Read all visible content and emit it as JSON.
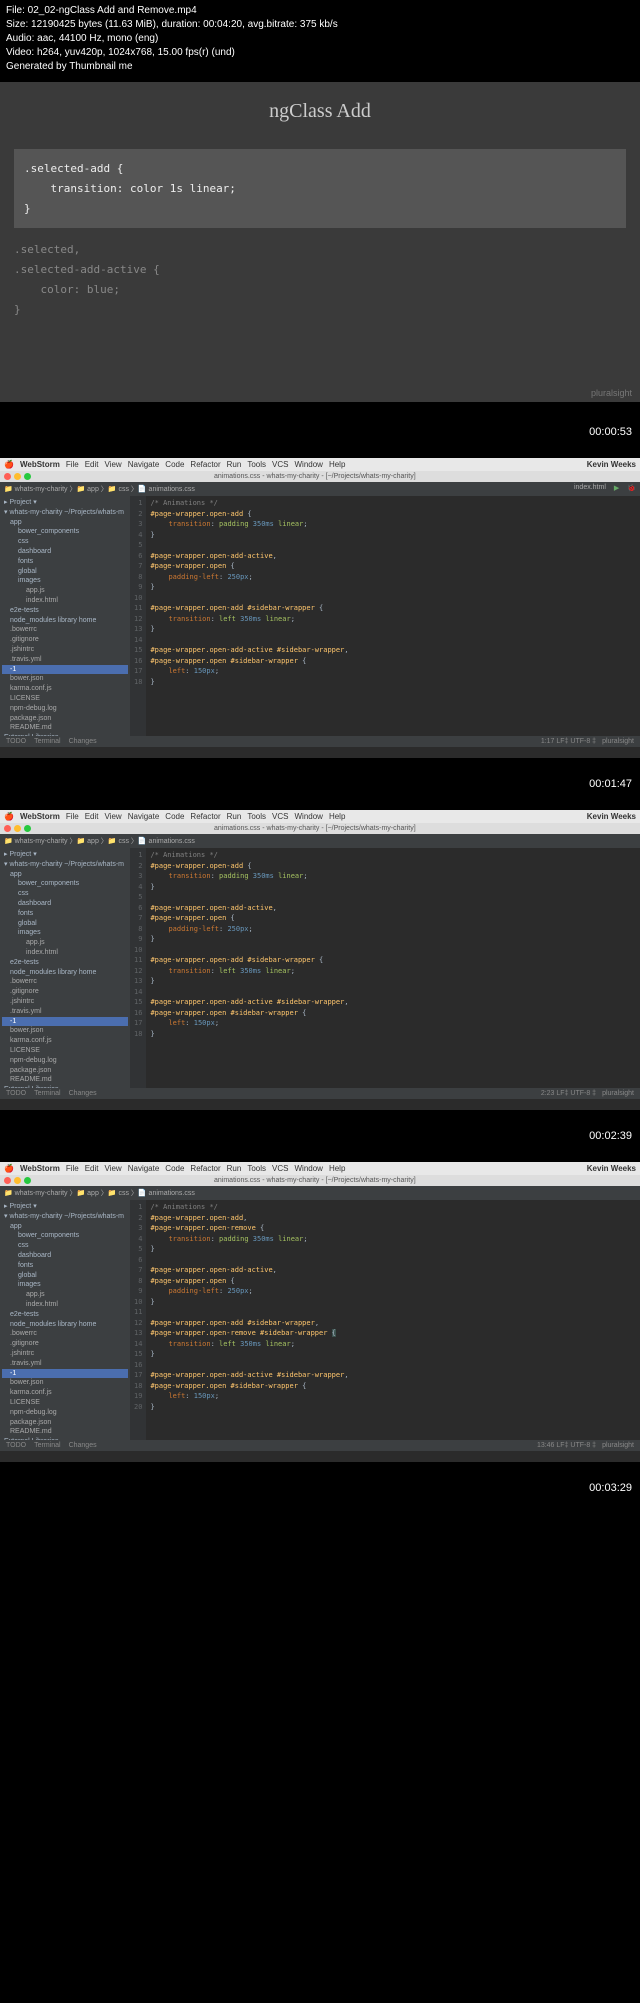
{
  "meta": {
    "file": "File: 02_02-ngClass Add and Remove.mp4",
    "size": "Size: 12190425 bytes (11.63 MiB), duration: 00:04:20, avg.bitrate: 375 kb/s",
    "audio": "Audio: aac, 44100 Hz, mono (eng)",
    "video": "Video: h264, yuv420p, 1024x768, 15.00 fps(r) (und)",
    "gen": "Generated by Thumbnail me"
  },
  "slide1": {
    "title": "ngClass Add",
    "box_l1": ".selected-add {",
    "box_l2": "transition: color 1s linear;",
    "box_l3": "}",
    "faded_l1": ".selected,",
    "faded_l2": ".selected-add-active {",
    "faded_l3": "color: blue;",
    "faded_l4": "}",
    "brand": "pluralsight"
  },
  "ts": {
    "t1": "00:00:53",
    "t2": "00:01:47",
    "t3": "00:02:39",
    "t4": "00:03:29"
  },
  "menu": {
    "app": "WebStorm",
    "items": [
      "File",
      "Edit",
      "View",
      "Navigate",
      "Code",
      "Refactor",
      "Run",
      "Tools",
      "VCS",
      "Window",
      "Help"
    ],
    "user": "Kevin Weeks"
  },
  "tabbar": {
    "path": "animations.css - whats-my-charity - [~/Projects/whats-my-charity]",
    "right": "index.html"
  },
  "tree": {
    "root": "whats-my-charity ~/Projects/whats-m",
    "items": [
      {
        "t": "app",
        "c": "ti1 folder"
      },
      {
        "t": "bower_components",
        "c": "ti2 folder"
      },
      {
        "t": "css",
        "c": "ti2 folder"
      },
      {
        "t": "dashboard",
        "c": "ti2 folder"
      },
      {
        "t": "fonts",
        "c": "ti2 folder"
      },
      {
        "t": "global",
        "c": "ti2 folder"
      },
      {
        "t": "images",
        "c": "ti2 folder"
      },
      {
        "t": "app.js",
        "c": "ti3"
      },
      {
        "t": "index.html",
        "c": "ti3"
      },
      {
        "t": "e2e-tests",
        "c": "ti1 folder"
      },
      {
        "t": "node_modules  library home",
        "c": "ti1 folder"
      },
      {
        "t": ".bowerrc",
        "c": "ti1"
      },
      {
        "t": ".gitignore",
        "c": "ti1"
      },
      {
        "t": ".jshintrc",
        "c": "ti1"
      },
      {
        "t": ".travis.yml",
        "c": "ti1"
      },
      {
        "t": "-1",
        "c": "ti1 sel"
      },
      {
        "t": "bower.json",
        "c": "ti1"
      },
      {
        "t": "karma.conf.js",
        "c": "ti1"
      },
      {
        "t": "LICENSE",
        "c": "ti1"
      },
      {
        "t": "npm-debug.log",
        "c": "ti1"
      },
      {
        "t": "package.json",
        "c": "ti1"
      },
      {
        "t": "README.md",
        "c": "ti1"
      },
      {
        "t": "External Libraries",
        "c": "folder"
      }
    ]
  },
  "editor_tabs": {
    "t1": "index.html",
    "t2": "app.js",
    "t3": "animations.css"
  },
  "code1": {
    "lines": [
      {
        "n": "1",
        "h": "<span class='c-comment'>/* Animations */</span>"
      },
      {
        "n": "2",
        "h": "<span class='c-sel'>#page-wrapper.open-add</span> {"
      },
      {
        "n": "3",
        "h": "<span class='indent'></span><span class='c-prop'>transition</span>: <span class='c-val'>padding</span> <span class='c-num'>350ms</span> <span class='c-val'>linear</span>;"
      },
      {
        "n": "4",
        "h": "}"
      },
      {
        "n": "5",
        "h": ""
      },
      {
        "n": "6",
        "h": "<span class='c-sel'>#page-wrapper.open-add-active</span>,"
      },
      {
        "n": "7",
        "h": "<span class='c-sel'>#page-wrapper.open</span> {"
      },
      {
        "n": "8",
        "h": "<span class='indent'></span><span class='c-prop'>padding-left</span>: <span class='c-num'>250px</span>;"
      },
      {
        "n": "9",
        "h": "}"
      },
      {
        "n": "10",
        "h": ""
      },
      {
        "n": "11",
        "h": "<span class='c-sel'>#page-wrapper.open-add #sidebar-wrapper</span> {"
      },
      {
        "n": "12",
        "h": "<span class='indent'></span><span class='c-prop'>transition</span>: <span class='c-val'>left</span> <span class='c-num'>350ms</span> <span class='c-val'>linear</span>;"
      },
      {
        "n": "13",
        "h": "}"
      },
      {
        "n": "14",
        "h": ""
      },
      {
        "n": "15",
        "h": "<span class='c-sel'>#page-wrapper.open-add-active #sidebar-wrapper</span>,"
      },
      {
        "n": "16",
        "h": "<span class='c-sel'>#page-wrapper.open #sidebar-wrapper</span> {"
      },
      {
        "n": "17",
        "h": "<span class='indent'></span><span class='c-prop'>left</span>: <span class='c-num'>150px</span>;"
      },
      {
        "n": "18",
        "h": "}"
      }
    ]
  },
  "code3": {
    "lines": [
      {
        "n": "1",
        "h": "<span class='c-comment'>/* Animations */</span>"
      },
      {
        "n": "2",
        "h": "<span class='c-sel'>#page-wrapper.open-add</span>,"
      },
      {
        "n": "3",
        "h": "<span class='c-sel'>#page-wrapper.open-remove</span> {"
      },
      {
        "n": "4",
        "h": "<span class='indent'></span><span class='c-prop'>transition</span>: <span class='c-val'>padding</span> <span class='c-num'>350ms</span> <span class='c-val'>linear</span>;"
      },
      {
        "n": "5",
        "h": "}"
      },
      {
        "n": "6",
        "h": ""
      },
      {
        "n": "7",
        "h": "<span class='c-sel'>#page-wrapper.open-add-active</span>,"
      },
      {
        "n": "8",
        "h": "<span class='c-sel'>#page-wrapper.open</span> {"
      },
      {
        "n": "9",
        "h": "<span class='indent'></span><span class='c-prop'>padding-left</span>: <span class='c-num'>250px</span>;"
      },
      {
        "n": "10",
        "h": "}"
      },
      {
        "n": "11",
        "h": ""
      },
      {
        "n": "12",
        "h": "<span class='c-sel'>#page-wrapper.open-add #sidebar-wrapper</span>,"
      },
      {
        "n": "13",
        "h": "<span class='c-sel'>#page-wrapper.open-remove #sidebar-wrapper</span> <span style='background:#3b514d'>{</span>"
      },
      {
        "n": "14",
        "h": "<span class='indent'></span><span class='c-prop'>transition</span>: <span class='c-val'>left</span> <span class='c-num'>350ms</span> <span class='c-val'>linear</span>;"
      },
      {
        "n": "15",
        "h": "}"
      },
      {
        "n": "16",
        "h": ""
      },
      {
        "n": "17",
        "h": "<span class='c-sel'>#page-wrapper.open-add-active #sidebar-wrapper</span>,"
      },
      {
        "n": "18",
        "h": "<span class='c-sel'>#page-wrapper.open #sidebar-wrapper</span> {"
      },
      {
        "n": "19",
        "h": "<span class='indent'></span><span class='c-prop'>left</span>: <span class='c-num'>150px</span>;"
      },
      {
        "n": "20",
        "h": "}"
      }
    ]
  },
  "status": {
    "todo": "TODO",
    "term": "Terminal",
    "chg": "Changes",
    "pos1": "1:17  LF‡  UTF-8 ‡",
    "pos2": "2:23  LF‡  UTF-8 ‡",
    "pos3": "13:46  LF‡  UTF-8 ‡",
    "brand": "pluralsight"
  }
}
